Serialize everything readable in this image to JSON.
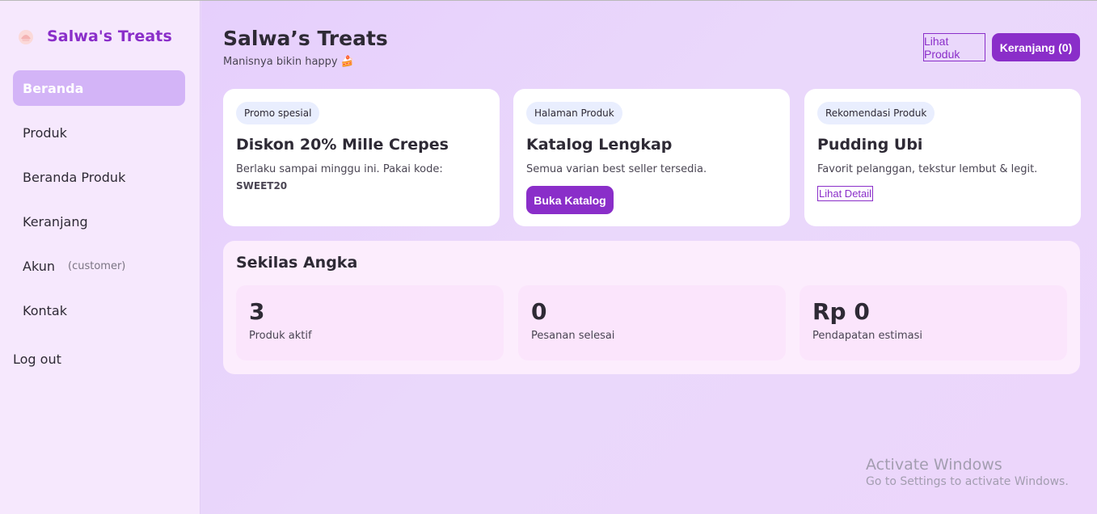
{
  "sidebar": {
    "brand": "Salwa's Treats",
    "items": [
      {
        "label": "Beranda"
      },
      {
        "label": "Produk"
      },
      {
        "label": "Beranda Produk"
      },
      {
        "label": "Keranjang"
      },
      {
        "label": "Akun",
        "sub": "(customer)"
      },
      {
        "label": "Kontak"
      }
    ],
    "logout": "Log out"
  },
  "header": {
    "title": "Salwa’s Treats",
    "subtitle": "Manisnya bikin happy 🍰",
    "view_products": "Lihat Produk",
    "cart": "Keranjang (0)"
  },
  "cards": [
    {
      "chip": "Promo spesial",
      "title": "Diskon 20% Mille Crepes",
      "text": "Berlaku sampai minggu ini. Pakai kode:",
      "code": "SWEET20"
    },
    {
      "chip": "Halaman Produk",
      "title": "Katalog Lengkap",
      "text": "Semua varian best seller tersedia.",
      "button": "Buka Katalog"
    },
    {
      "chip": "Rekomendasi Produk",
      "title": "Pudding Ubi",
      "text": "Favorit pelanggan, tekstur lembut & legit.",
      "link": "Lihat Detail"
    }
  ],
  "stats": {
    "title": "Sekilas Angka",
    "items": [
      {
        "value": "3",
        "label": "Produk aktif"
      },
      {
        "value": "0",
        "label": "Pesanan selesai"
      },
      {
        "value": "Rp 0",
        "label": "Pendapatan estimasi"
      }
    ]
  },
  "watermark": {
    "title": "Activate Windows",
    "subtitle": "Go to Settings to activate Windows."
  },
  "colors": {
    "accent": "#8a2ec9",
    "active_nav": "#d3b4f7",
    "sidebar_bg": "#f6e8fd"
  }
}
